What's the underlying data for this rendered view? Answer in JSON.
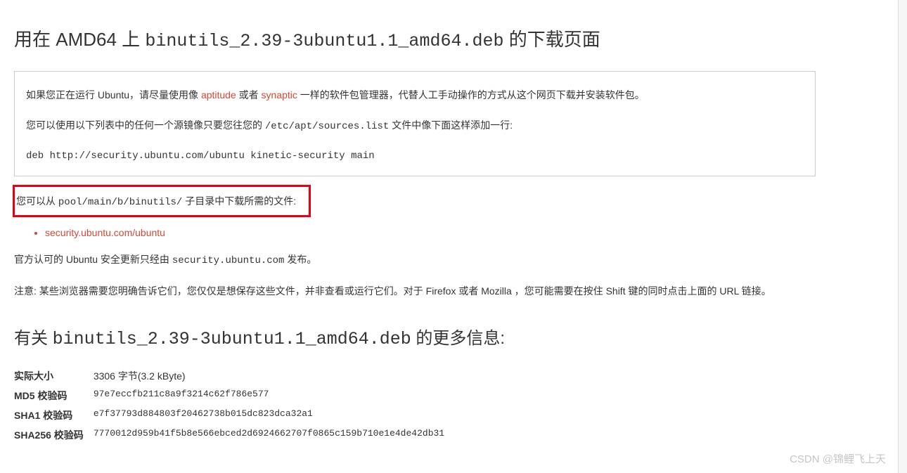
{
  "title": {
    "prefix": "用在 AMD64 上 ",
    "filename": "binutils_2.39-3ubuntu1.1_amd64.deb",
    "suffix": " 的下载页面"
  },
  "box": {
    "line1_pre": "如果您正在运行 Ubuntu，请尽量使用像 ",
    "aptitude": "aptitude",
    "or": " 或者 ",
    "synaptic": "synaptic",
    "line1_post": " 一样的软件包管理器，代替人工手动操作的方式从这个网页下载并安装软件包。",
    "line2_pre": "您可以使用以下列表中的任何一个源镜像只要您往您的 ",
    "sources_path": "/etc/apt/sources.list",
    "line2_post": " 文件中像下面这样添加一行:",
    "deb_line": "deb http://security.ubuntu.com/ubuntu kinetic-security main"
  },
  "pool": {
    "pre": "您可以从 ",
    "path": "pool/main/b/binutils/",
    "post": " 子目录中下载所需的文件:"
  },
  "mirror_link": "security.ubuntu.com/ubuntu",
  "official": {
    "pre": "官方认可的 Ubuntu 安全更新只经由 ",
    "host": "security.ubuntu.com",
    "post": " 发布。"
  },
  "note": "注意: 某些浏览器需要您明确告诉它们，您仅仅是想保存这些文件，并非查看或运行它们。对于 Firefox 或者 Mozilla ，您可能需要在按住 Shift 键的同时点击上面的 URL 链接。",
  "subtitle": {
    "pre": "有关 ",
    "filename": "binutils_2.39-3ubuntu1.1_amd64.deb",
    "post": " 的更多信息:"
  },
  "info_rows": [
    {
      "label": "实际大小",
      "value": "3306 字节(3.2 kByte)"
    },
    {
      "label": "MD5 校验码",
      "value": "97e7eccfb211c8a9f3214c62f786e577"
    },
    {
      "label": "SHA1 校验码",
      "value": "e7f37793d884803f20462738b015dc823dca32a1"
    },
    {
      "label": "SHA256 校验码",
      "value": "7770012d959b41f5b8e566ebced2d6924662707f0865c159b710e1e4de42db31"
    }
  ],
  "watermark": "CSDN @锦鲤飞上天"
}
